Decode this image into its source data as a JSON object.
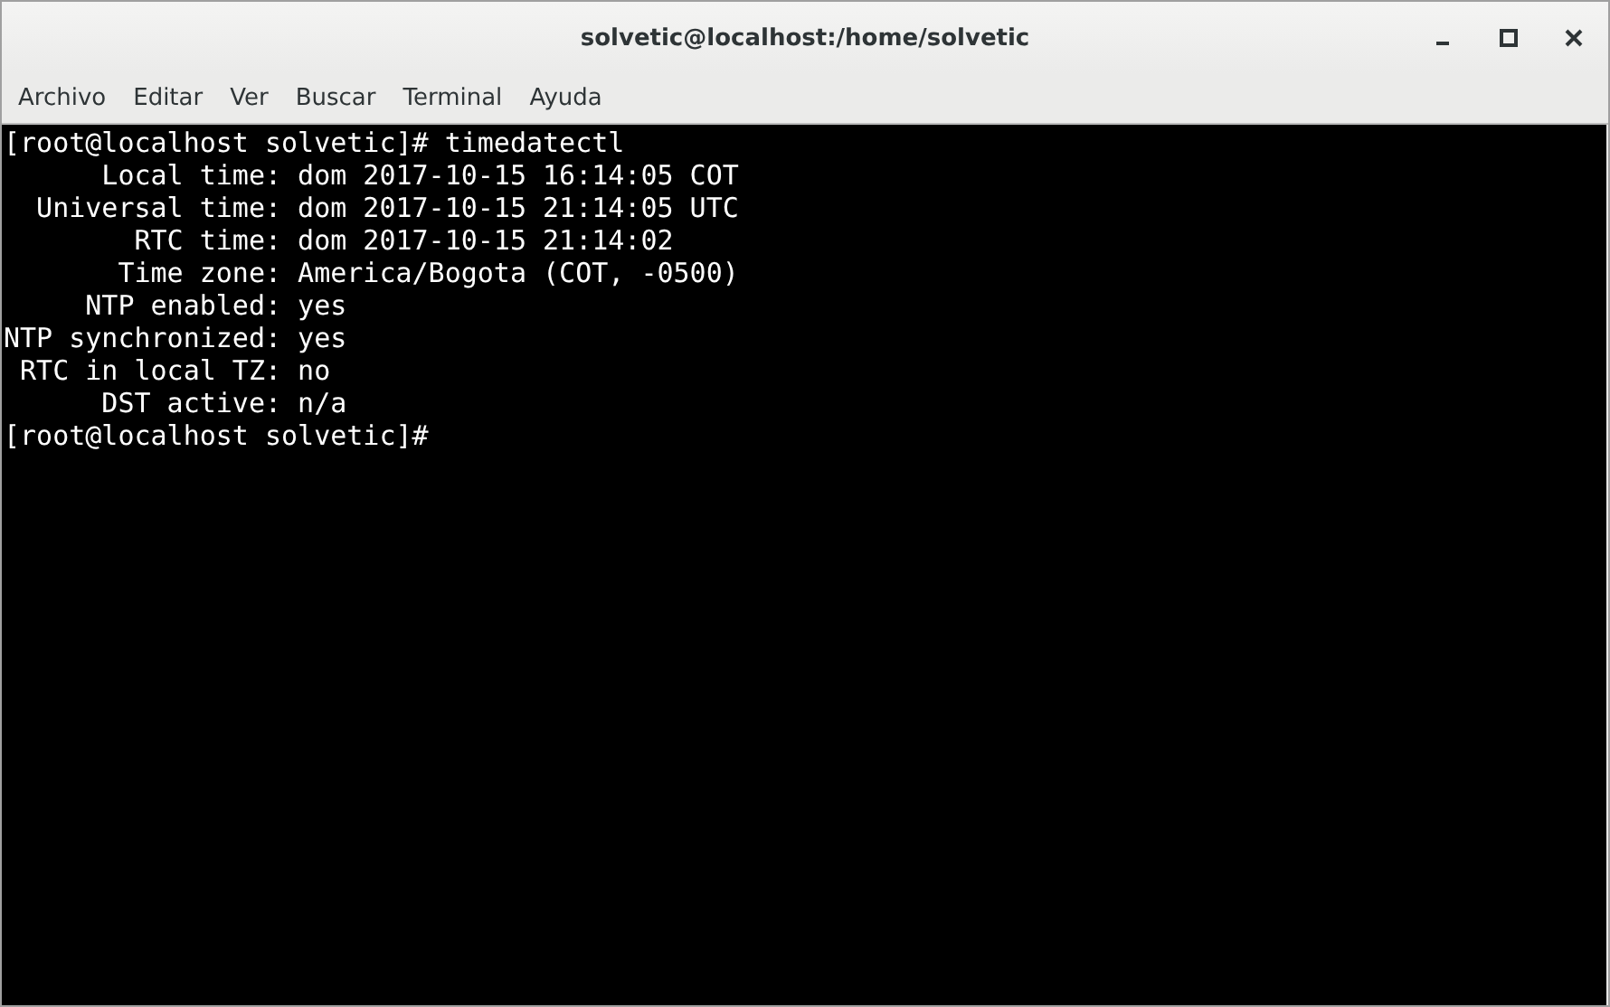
{
  "window": {
    "title": "solvetic@localhost:/home/solvetic"
  },
  "menu": [
    "Archivo",
    "Editar",
    "Ver",
    "Buscar",
    "Terminal",
    "Ayuda"
  ],
  "terminal": {
    "lines": [
      "[root@localhost solvetic]# timedatectl",
      "      Local time: dom 2017-10-15 16:14:05 COT",
      "  Universal time: dom 2017-10-15 21:14:05 UTC",
      "        RTC time: dom 2017-10-15 21:14:02",
      "       Time zone: America/Bogota (COT, -0500)",
      "     NTP enabled: yes",
      "NTP synchronized: yes",
      " RTC in local TZ: no",
      "      DST active: n/a",
      "[root@localhost solvetic]#"
    ]
  }
}
